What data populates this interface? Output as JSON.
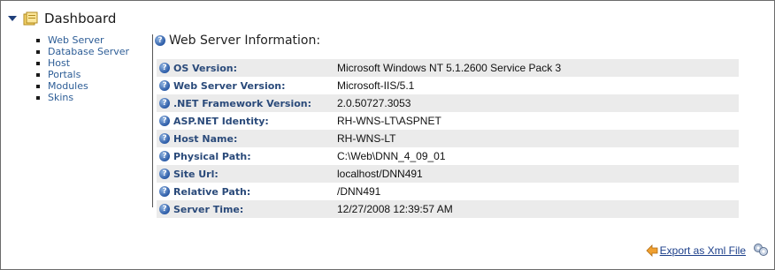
{
  "header": {
    "title": "Dashboard",
    "icon": "folder-icon"
  },
  "nav": {
    "items": [
      {
        "label": "Web Server"
      },
      {
        "label": "Database Server"
      },
      {
        "label": "Host"
      },
      {
        "label": "Portals"
      },
      {
        "label": "Modules"
      },
      {
        "label": "Skins"
      }
    ]
  },
  "section": {
    "title": "Web Server Information:"
  },
  "rows": [
    {
      "label": "OS Version:",
      "value": "Microsoft Windows NT 5.1.2600 Service Pack 3"
    },
    {
      "label": "Web Server Version:",
      "value": "Microsoft-IIS/5.1"
    },
    {
      "label": ".NET Framework Version:",
      "value": "2.0.50727.3053"
    },
    {
      "label": "ASP.NET Identity:",
      "value": "RH-WNS-LT\\ASPNET"
    },
    {
      "label": "Host Name:",
      "value": "RH-WNS-LT"
    },
    {
      "label": "Physical Path:",
      "value": "C:\\Web\\DNN_4_09_01"
    },
    {
      "label": "Site Url:",
      "value": "localhost/DNN491"
    },
    {
      "label": "Relative Path:",
      "value": "/DNN491"
    },
    {
      "label": "Server Time:",
      "value": "12/27/2008 12:39:57 AM"
    }
  ],
  "footer": {
    "export_label": "Export as Xml File"
  },
  "colors": {
    "link": "#2d5d96",
    "label": "#2a4a7a",
    "row_alt": "#ebebeb"
  }
}
